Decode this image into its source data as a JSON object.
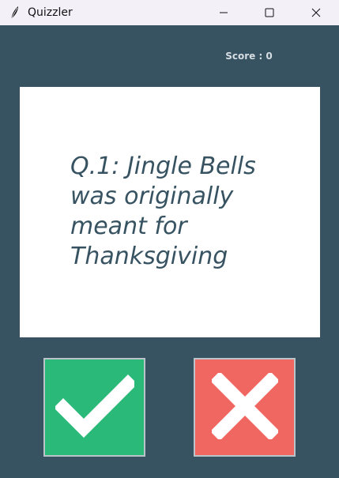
{
  "window": {
    "title": "Quizzler",
    "app_icon": "feather-icon",
    "controls": [
      "minimize-icon",
      "maximize-icon",
      "close-icon"
    ]
  },
  "score": {
    "label": "Score : 0"
  },
  "question": {
    "text": "Q.1: Jingle Bells was originally meant for Thanksgiving"
  },
  "answers": {
    "true_icon": "checkmark-icon",
    "false_icon": "cross-icon"
  },
  "colors": {
    "theme_background": "#375362",
    "card_background": "#ffffff",
    "question_text": "#375362",
    "true_button": "#2bb97a",
    "false_button": "#ef6760"
  }
}
